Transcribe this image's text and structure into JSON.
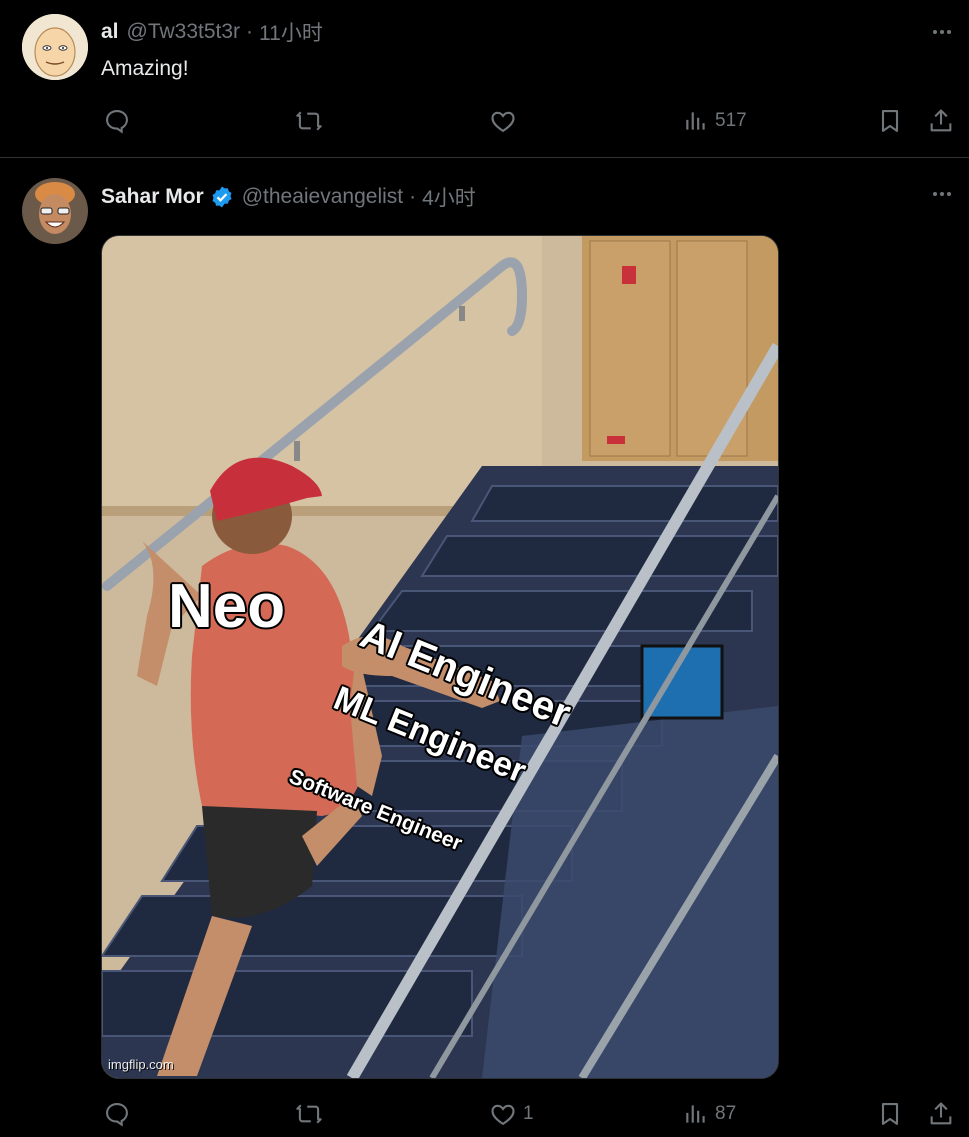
{
  "tweet1": {
    "name": "al",
    "handle": "@Tw33t5t3r",
    "time": "11小时",
    "text": "Amazing!",
    "views": "517",
    "avatar_icon": "bald-cartoon-avatar-icon"
  },
  "tweet2": {
    "name": "Sahar Mor",
    "handle": "@theaievangelist",
    "time": "4小时",
    "likes": "1",
    "views": "87",
    "verified_color": "#1d9bf0",
    "avatar_icon": "person-avatar-icon",
    "meme": {
      "neo": "Neo",
      "ai": "AI Engineer",
      "ml": "ML Engineer",
      "sw": "Software Engineer",
      "watermark": "imgflip.com"
    }
  },
  "colors": {
    "background": "#000000",
    "text": "#e7e9ea",
    "muted": "#71767b",
    "divider": "#2f3336"
  }
}
